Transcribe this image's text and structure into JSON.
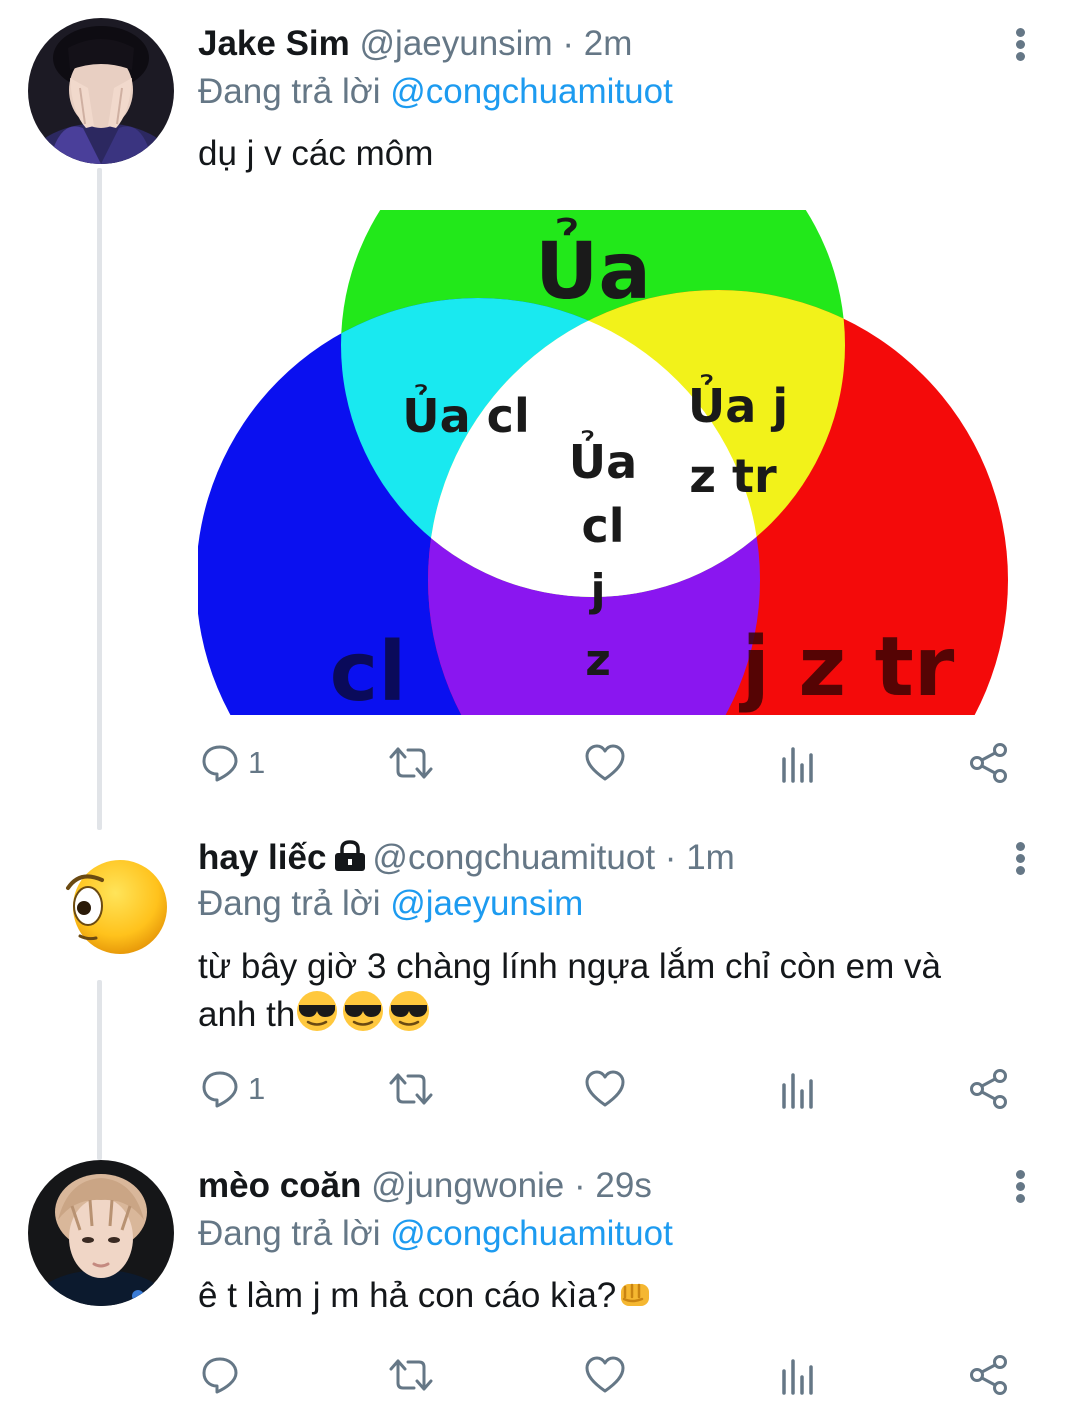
{
  "tweets": [
    {
      "name": "Jake Sim",
      "handle": "@jaeyunsim",
      "sep": "·",
      "time": "2m",
      "reply_prefix": "Đang trả lời",
      "reply_to": "@congchuamituot",
      "text": "dụ j v các môm",
      "replies": "1",
      "image": {
        "label_top": "Ủa",
        "label_left_mid": "Ủa cl",
        "label_right_mid_1": "Ủa j",
        "label_right_mid_2": "z tr",
        "label_center_1": "Ủa",
        "label_center_2": "cl",
        "label_bottom_1": "j",
        "label_bottom_2": "z",
        "label_left": "cl",
        "label_right": "j z tr",
        "colors": {
          "green": "#22e81a",
          "blue": "#0a10f0",
          "red": "#f40a0a",
          "cyan": "#19e9f0",
          "yellow": "#f2f21a",
          "purple": "#8a16f0",
          "white": "#ffffff"
        }
      }
    },
    {
      "name": "hay liếc",
      "handle": "@congchuamituot",
      "sep": "·",
      "time": "1m",
      "reply_prefix": "Đang trả lời",
      "reply_to": "@jaeyunsim",
      "text_line1": "từ bây giờ 3 chàng lính ngựa lắm chỉ còn em và",
      "text_line2": "anh th",
      "replies": "1"
    },
    {
      "name": "mèo coăn",
      "handle": "@jungwonie",
      "sep": "·",
      "time": "29s",
      "reply_prefix": "Đang trả lời",
      "reply_to": "@congchuamituot",
      "text": "ê t làm j m hả con cáo kìa?",
      "replies": ""
    }
  ],
  "icons": [
    "reply-icon",
    "retweet-icon",
    "like-icon",
    "views-icon",
    "share-icon",
    "more-icon",
    "lock-icon"
  ],
  "accent": "#1d9bf0"
}
